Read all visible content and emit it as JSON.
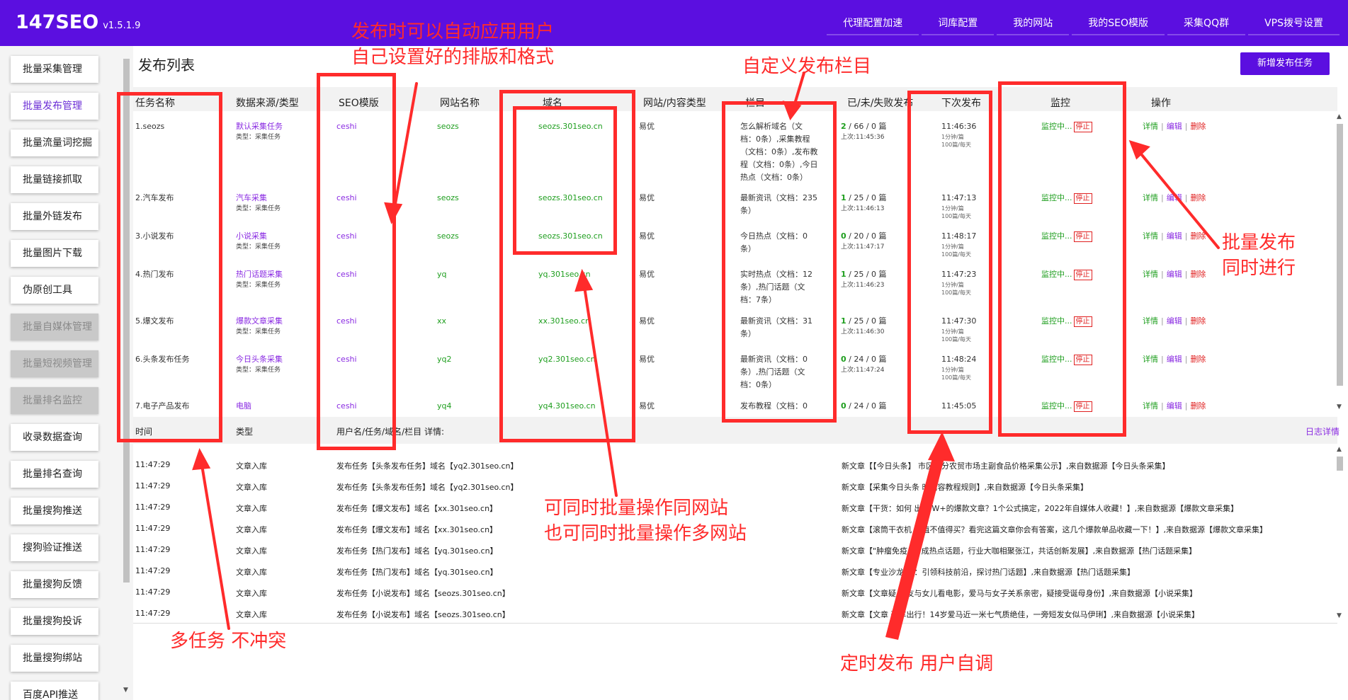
{
  "app": {
    "name": "147SEO",
    "version": "v1.5.1.9"
  },
  "nav": [
    "代理配置加速",
    "词库配置",
    "我的网站",
    "我的SEO模版",
    "采集QQ群",
    "VPS拨号设置"
  ],
  "sidebar": [
    {
      "label": "批量采集管理",
      "state": "normal"
    },
    {
      "label": "批量发布管理",
      "state": "active"
    },
    {
      "label": "批量流量词挖掘",
      "state": "normal"
    },
    {
      "label": "批量链接抓取",
      "state": "normal"
    },
    {
      "label": "批量外链发布",
      "state": "normal"
    },
    {
      "label": "批量图片下载",
      "state": "normal"
    },
    {
      "label": "伪原创工具",
      "state": "normal"
    },
    {
      "label": "批量自媒体管理",
      "state": "disabled"
    },
    {
      "label": "批量短视频管理",
      "state": "disabled"
    },
    {
      "label": "批量排名监控",
      "state": "disabled"
    },
    {
      "label": "收录数据查询",
      "state": "normal"
    },
    {
      "label": "批量排名查询",
      "state": "normal"
    },
    {
      "label": "批量搜狗推送",
      "state": "normal"
    },
    {
      "label": "搜狗验证推送",
      "state": "normal"
    },
    {
      "label": "批量搜狗反馈",
      "state": "normal"
    },
    {
      "label": "批量搜狗投诉",
      "state": "normal"
    },
    {
      "label": "批量搜狗绑站",
      "state": "normal"
    },
    {
      "label": "百度API推送",
      "state": "normal"
    }
  ],
  "main": {
    "title": "发布列表",
    "add_button": "新增发布任务",
    "columns": [
      "任务名称",
      "数据来源/类型",
      "SEO模版",
      "网站名称",
      "域名",
      "网站/内容类型",
      "栏目",
      "已/未/失败发布",
      "下次发布",
      "监控",
      "操作"
    ],
    "monitor_label": "监控中...",
    "stop_label": "停止",
    "op_detail": "详情",
    "op_edit": "编辑",
    "op_delete": "删除",
    "rows": [
      {
        "name": "1.seozs",
        "source": "默认采集任务",
        "source_type": "类型：采集任务",
        "template": "ceshi",
        "site": "seozs",
        "domain": "seozs.301seo.cn",
        "content_type": "易优",
        "category": [
          "怎么解析域名（文",
          "档：0条）,采集教程",
          "（文档：0条）,发布教",
          "程（文档：0条）,今日",
          "热点（文档：0条）"
        ],
        "stat_a": "2",
        "stat_b": " / 66 / 0 篇",
        "last": "上次:11:45:36",
        "next": "11:46:36",
        "interval": "1分钟/篇",
        "limit": "100篇/每天"
      },
      {
        "name": "2.汽车发布",
        "source": "汽车采集",
        "source_type": "类型：采集任务",
        "template": "ceshi",
        "site": "seozs",
        "domain": "seozs.301seo.cn",
        "content_type": "易优",
        "category": [
          "最新资讯（文档：235",
          "条）"
        ],
        "stat_a": "1",
        "stat_b": " / 25 / 0 篇",
        "last": "上次:11:46:13",
        "next": "11:47:13",
        "interval": "1分钟/篇",
        "limit": "100篇/每天"
      },
      {
        "name": "3.小说发布",
        "source": "小说采集",
        "source_type": "类型：采集任务",
        "template": "ceshi",
        "site": "seozs",
        "domain": "seozs.301seo.cn",
        "content_type": "易优",
        "category": [
          "今日热点（文档：0",
          "条）"
        ],
        "stat_a": "0",
        "stat_b": " / 20 / 0 篇",
        "last": "上次:11:47:17",
        "next": "11:48:17",
        "interval": "1分钟/篇",
        "limit": "100篇/每天"
      },
      {
        "name": "4.热门发布",
        "source": "热门话题采集",
        "source_type": "类型：采集任务",
        "template": "ceshi",
        "site": "yq",
        "domain": "yq.301seo.cn",
        "content_type": "易优",
        "category": [
          "实时热点（文档：12",
          "条）,热门话题（文",
          "档：7条）"
        ],
        "stat_a": "1",
        "stat_b": " / 25 / 0 篇",
        "last": "上次:11:46:23",
        "next": "11:47:23",
        "interval": "1分钟/篇",
        "limit": "100篇/每天"
      },
      {
        "name": "5.爆文发布",
        "source": "爆款文章采集",
        "source_type": "类型：采集任务",
        "template": "ceshi",
        "site": "xx",
        "domain": "xx.301seo.cn",
        "content_type": "易优",
        "category": [
          "最新资讯（文档：31",
          "条）"
        ],
        "stat_a": "1",
        "stat_b": " / 25 / 0 篇",
        "last": "上次:11:46:30",
        "next": "11:47:30",
        "interval": "1分钟/篇",
        "limit": "100篇/每天"
      },
      {
        "name": "6.头条发布任务",
        "source": "今日头条采集",
        "source_type": "类型：采集任务",
        "template": "ceshi",
        "site": "yq2",
        "domain": "yq2.301seo.cn",
        "content_type": "易优",
        "category": [
          "最新资讯（文档：0",
          "条）,热门话题（文",
          "档：0条）"
        ],
        "stat_a": "0",
        "stat_b": " / 24 / 0 篇",
        "last": "上次:11:47:24",
        "next": "11:48:24",
        "interval": "1分钟/篇",
        "limit": "100篇/每天"
      },
      {
        "name": "7.电子产品发布",
        "source": "电脑",
        "source_type": "",
        "template": "ceshi",
        "site": "yq4",
        "domain": "yq4.301seo.cn",
        "content_type": "易优",
        "category": [
          "发布教程（文档：0"
        ],
        "stat_a": "0",
        "stat_b": " / 24 / 0 篇",
        "last": "",
        "next": "11:45:05",
        "interval": "",
        "limit": ""
      }
    ]
  },
  "log": {
    "columns": [
      "时间",
      "类型",
      "用户名/任务/域名/栏目 详情:"
    ],
    "detail_link": "日志详情",
    "rows": [
      {
        "time": "11:47:29",
        "type": "文章入库",
        "task": "发布任务【头条发布任务】域名【yq2.301seo.cn】",
        "detail": "新文章【【今日头条】   市区部分农贸市场主副食品价格采集公示】,来自数据源【今日头条采集】"
      },
      {
        "time": "11:47:29",
        "type": "文章入库",
        "task": "发布任务【头条发布任务】域名【yq2.301seo.cn】",
        "detail": "新文章【采集今日头条    时内容教程规则】,来自数据源【今日头条采集】"
      },
      {
        "time": "11:47:29",
        "type": "文章入库",
        "task": "发布任务【爆文发布】域名【xx.301seo.cn】",
        "detail": "新文章【干货：如何    出10W+的爆款文章？1个公式搞定，2022年自媒体人收藏！】,来自数据源【爆款文章采集】"
      },
      {
        "time": "11:47:29",
        "type": "文章入库",
        "task": "发布任务【爆文发布】域名【xx.301seo.cn】",
        "detail": "新文章【滚筒干衣机   底值不值得买？看完这篇文章你会有答案，这几个爆款单品收藏一下！】,来自数据源【爆款文章采集】"
      },
      {
        "time": "11:47:29",
        "type": "文章入库",
        "task": "发布任务【热门发布】域名【yq.301seo.cn】",
        "detail": "新文章【\"肿瘤免疫    疗\"成热点话题，行业大咖相聚张江，共话创新发展】,来自数据源【热门话题采集】"
      },
      {
        "time": "11:47:29",
        "type": "文章入库",
        "task": "发布任务【热门发布】域名【yq.301seo.cn】",
        "detail": "新文章【专业沙龙    动：引领科技前沿，探讨热门话题】,来自数据源【热门话题采集】"
      },
      {
        "time": "11:47:29",
        "type": "文章入库",
        "task": "发布任务【小说发布】域名【seozs.301seo.cn】",
        "detail": "新文章【文章疑    女友与女儿看电影，爱马与女子关系亲密，疑接受诞母身份】,来自数据源【小说采集】"
      },
      {
        "time": "11:47:29",
        "type": "文章入库",
        "task": "发布任务【小说发布】域名【seozs.301seo.cn】",
        "detail": "新文章【文章    豪车出行！14岁爱马近一米七气质绝佳，一旁短发女似马伊琍】,来自数据源【小说采集】"
      }
    ]
  },
  "annotations": {
    "a1": [
      "发布时可以自动应用用户",
      "自己设置好的排版和格式"
    ],
    "a2": "自定义发布栏目",
    "a3": [
      "批量发布",
      "同时进行"
    ],
    "a4": [
      "可同时批量操作同网站",
      "也可同时批量操作多网站"
    ],
    "a5": "多任务 不冲突",
    "a6": "定时发布 用户自调",
    "color": "#ff2b2b"
  },
  "colors": {
    "brand": "#5b0fe0",
    "link_purple": "#8a2be2",
    "ok_green": "#1e9e1e",
    "alert_red": "#e02020"
  }
}
